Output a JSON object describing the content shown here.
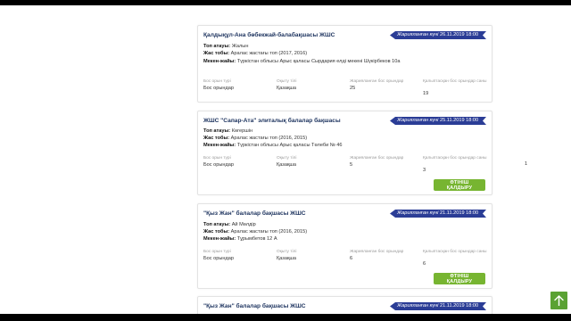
{
  "labels": {
    "group_name": "Топ атауы:",
    "age_group": "Жас тобы:",
    "address": "Мекен-жайы:",
    "published": "Жарияланған күні",
    "seat_type": "Бос орын түрі",
    "language": "Оқыту тілі",
    "announced_seats": "Жарияланған бос орындар",
    "remaining_seats": "Қалыптасқан бос орындар саны",
    "apply_button": "ӨТІНІШ ҚАЛДЫРУ"
  },
  "cards": [
    {
      "title": "Қалдықұл-Ана бөбекжай-балабақшасы ЖШС",
      "date": "26.11.2019 18:00",
      "group_name": "Жалын",
      "age_group": "Аралас жастағы топ (2017, 2016)",
      "address": "Түркістан облысы Арыс қаласы Сырдария елді мекені Шүкірбеков 10а",
      "seat_type": "Бос орындар",
      "language": "Қазақша",
      "announced_seats": "25",
      "remaining_seats": "19"
    },
    {
      "title": "ЖШС \"Сапар-Ата\" элиталық балалар бақшасы",
      "date": "25.11.2019 18:00",
      "group_name": "Көгершін",
      "age_group": "Аралас жастағы топ (2016, 2015)",
      "address": "Түркістан облысы Арыс қаласы Төлеби № 46",
      "seat_type": "Бос орындар",
      "language": "Қазақша",
      "announced_seats": "5",
      "remaining_seats": "3"
    },
    {
      "title": "\"Қыз Жан\" балалар бақшасы ЖШС",
      "date": "21.11.2019 18:00",
      "group_name": "Ай Мөлдір",
      "age_group": "Аралас жастағы топ (2016, 2015)",
      "address": "Тұрымбетов 12 А",
      "seat_type": "Бос орындар",
      "language": "Қазақша",
      "announced_seats": "6",
      "remaining_seats": "6"
    },
    {
      "title": "\"Қыз Жан\" балалар бақшасы ЖШС",
      "date": "21.11.2019 18:00"
    }
  ],
  "page_marker": "1",
  "colors": {
    "ribbon": "#2b3d96",
    "button": "#77b531",
    "title": "#1f3560",
    "scroll_top": "#5aa233"
  },
  "icons": {
    "scroll_top": "arrow-up-icon"
  }
}
